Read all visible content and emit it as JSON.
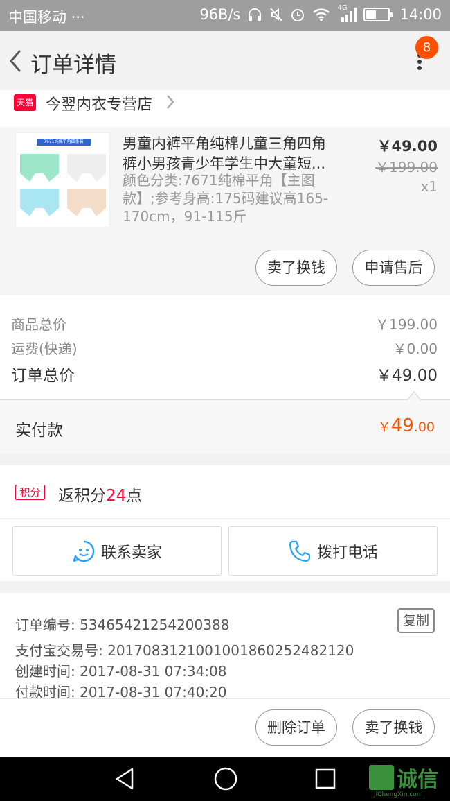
{
  "status_bar": {
    "carrier": "中国移动 ···",
    "net_speed": "96B/s",
    "network": "4G",
    "time": "14:00",
    "battery_level": 0.45
  },
  "header": {
    "title": "订单详情",
    "badge_count": "8"
  },
  "store": {
    "platform_tag": "天猫",
    "name": "今翌内衣专营店"
  },
  "product": {
    "thumb_caption": "7671纯棉平角四条装",
    "title": "男童内裤平角纯棉儿童三角四角裤小男孩青少年学生中大童短...",
    "sku": "颜色分类:7671纯棉平角【主图款】;参考身高:175码建议高165-170cm，91-115斤",
    "price": "￥49.00",
    "original_price": "￥199.00",
    "quantity": "x1",
    "buttons": {
      "sell": "卖了换钱",
      "after_sale": "申请售后"
    }
  },
  "price_detail": {
    "rows": [
      {
        "label": "商品总价",
        "value": "￥199.00"
      },
      {
        "label": "运费(快递)",
        "value": "￥0.00"
      }
    ],
    "total_label": "订单总价",
    "total_value": "￥49.00",
    "paid_label": "实付款",
    "paid_currency": "￥",
    "paid_integer": "49",
    "paid_decimal": ".00"
  },
  "points": {
    "tag": "积分",
    "prefix": "返积分",
    "amount": "24",
    "suffix": "点"
  },
  "contact": {
    "seller": "联系卖家",
    "call": "拨打电话"
  },
  "order_info": {
    "order_no": "订单编号: 53465421254200388",
    "alipay_no": "支付宝交易号: 2017083121001001860252482120",
    "created": "创建时间: 2017-08-31 07:34:08",
    "paid": "付款时间: 2017-08-31 07:40:20",
    "copy_label": "复制"
  },
  "actions": {
    "delete": "删除订单",
    "sell": "卖了换钱"
  },
  "watermark": {
    "text": "诚信",
    "url": "JiChengXin.com"
  },
  "colors": {
    "accent": "#ff5000",
    "tmall": "#ff0036",
    "status_bar": "#9e9e9e"
  }
}
